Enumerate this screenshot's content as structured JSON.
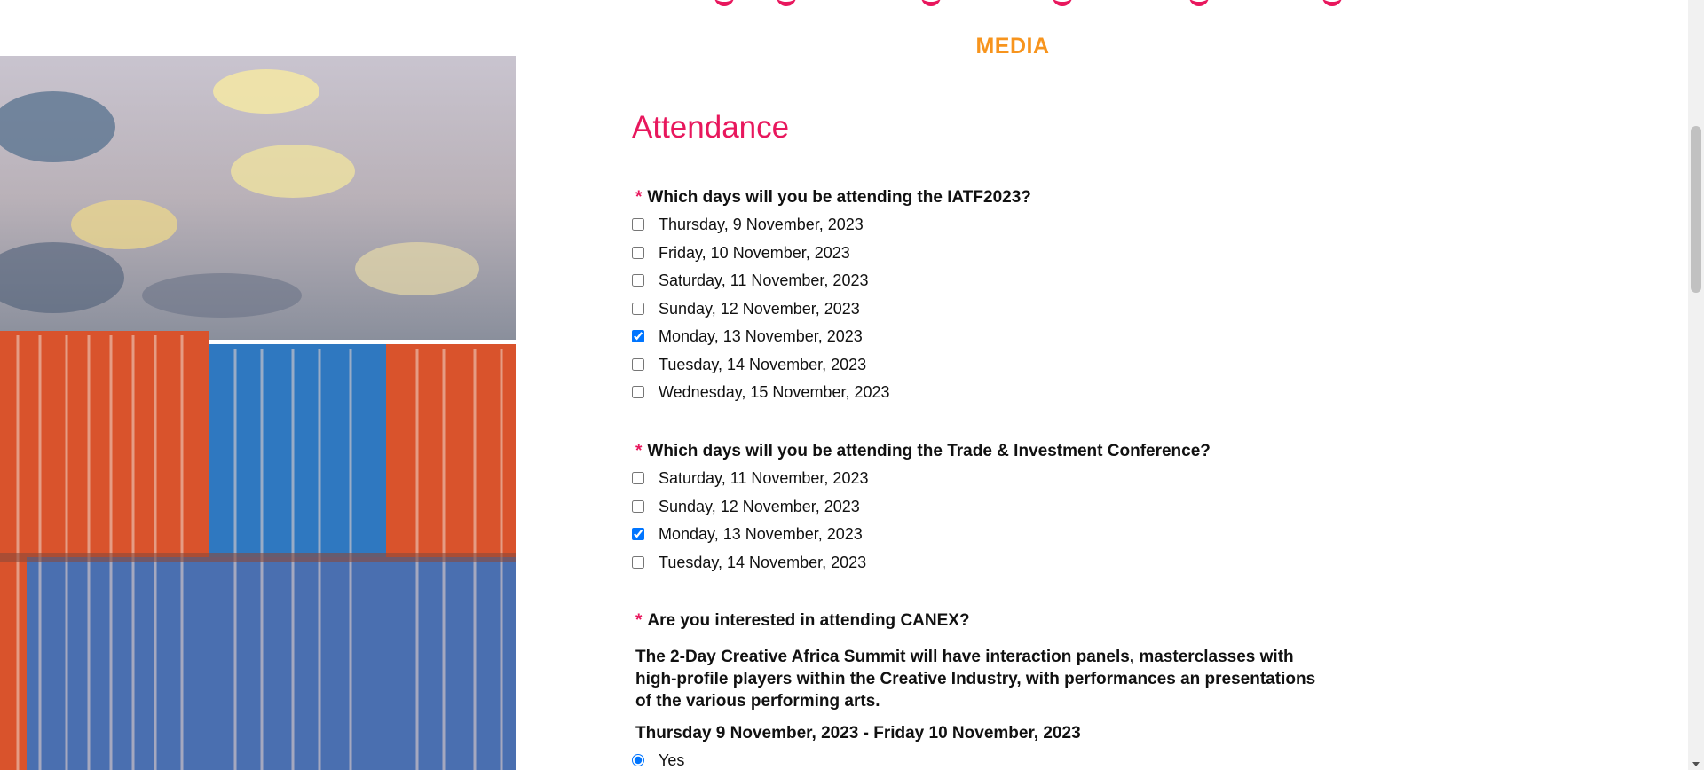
{
  "header": {
    "media_label": "MEDIA"
  },
  "attendance": {
    "title": "Attendance",
    "iatf": {
      "question": "Which days will you be attending the IATF2023?",
      "options": [
        {
          "label": "Thursday, 9 November, 2023",
          "checked": false
        },
        {
          "label": "Friday, 10 November, 2023",
          "checked": false
        },
        {
          "label": "Saturday, 11 November, 2023",
          "checked": false
        },
        {
          "label": "Sunday, 12 November, 2023",
          "checked": false
        },
        {
          "label": "Monday, 13 November, 2023",
          "checked": true
        },
        {
          "label": "Tuesday, 14 November, 2023",
          "checked": false
        },
        {
          "label": "Wednesday, 15 November, 2023",
          "checked": false
        }
      ]
    },
    "conference": {
      "question": "Which days will you be attending the Trade & Investment Conference?",
      "options": [
        {
          "label": "Saturday, 11 November, 2023",
          "checked": false
        },
        {
          "label": "Sunday, 12 November, 2023",
          "checked": false
        },
        {
          "label": "Monday, 13 November, 2023",
          "checked": true
        },
        {
          "label": "Tuesday, 14 November, 2023",
          "checked": false
        }
      ]
    },
    "canex": {
      "question": "Are you interested in attending CANEX?",
      "description": "The 2-Day Creative Africa Summit will have interaction panels, masterclasses with high-profile players within the Creative Industry, with performances an presentations of the various performing arts.",
      "dates": "Thursday 9 November, 2023 - Friday 10 November, 2023",
      "options": [
        {
          "label": "Yes",
          "checked": true
        }
      ]
    },
    "required_marker": "*"
  },
  "colors": {
    "accent_pink": "#e8175d",
    "media_orange": "#f7941d",
    "checkbox_blue": "#0b63ce"
  }
}
